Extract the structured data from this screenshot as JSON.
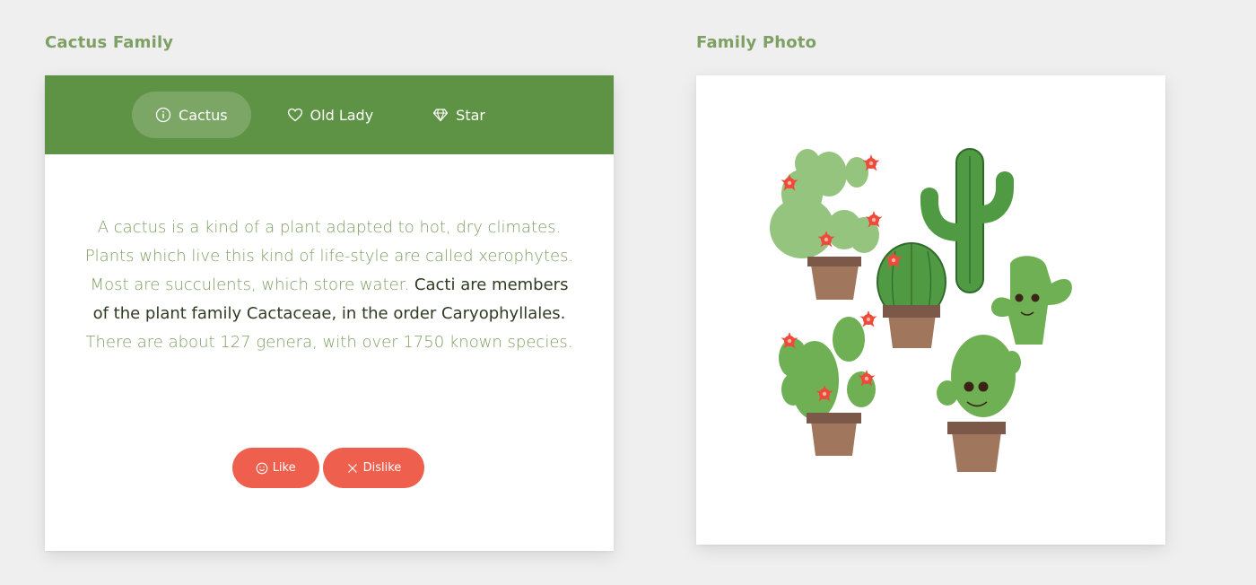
{
  "left_section": {
    "title": "Cactus Family"
  },
  "right_section": {
    "title": "Family Photo"
  },
  "tabs": [
    {
      "label": "Cactus",
      "icon": "info-icon",
      "active": true
    },
    {
      "label": "Old Lady",
      "icon": "heart-icon",
      "active": false
    },
    {
      "label": "Star",
      "icon": "diamond-icon",
      "active": false
    }
  ],
  "description": {
    "part1": "A cactus is a kind of a plant adapted to hot, dry climates. Plants which live this kind of life-style are called xerophytes. Most are succulents, which store water.",
    "part2": "Cacti are members of the plant family Cactaceae, in the order Caryophyllales.",
    "part3": "There are about 127 genera, with over 1750 known species."
  },
  "buttons": {
    "like": "Like",
    "dislike": "Dislike"
  },
  "colors": {
    "background": "#efefef",
    "tabbar": "#5e9345",
    "title": "#7fa064",
    "button": "#ef5f4d"
  }
}
